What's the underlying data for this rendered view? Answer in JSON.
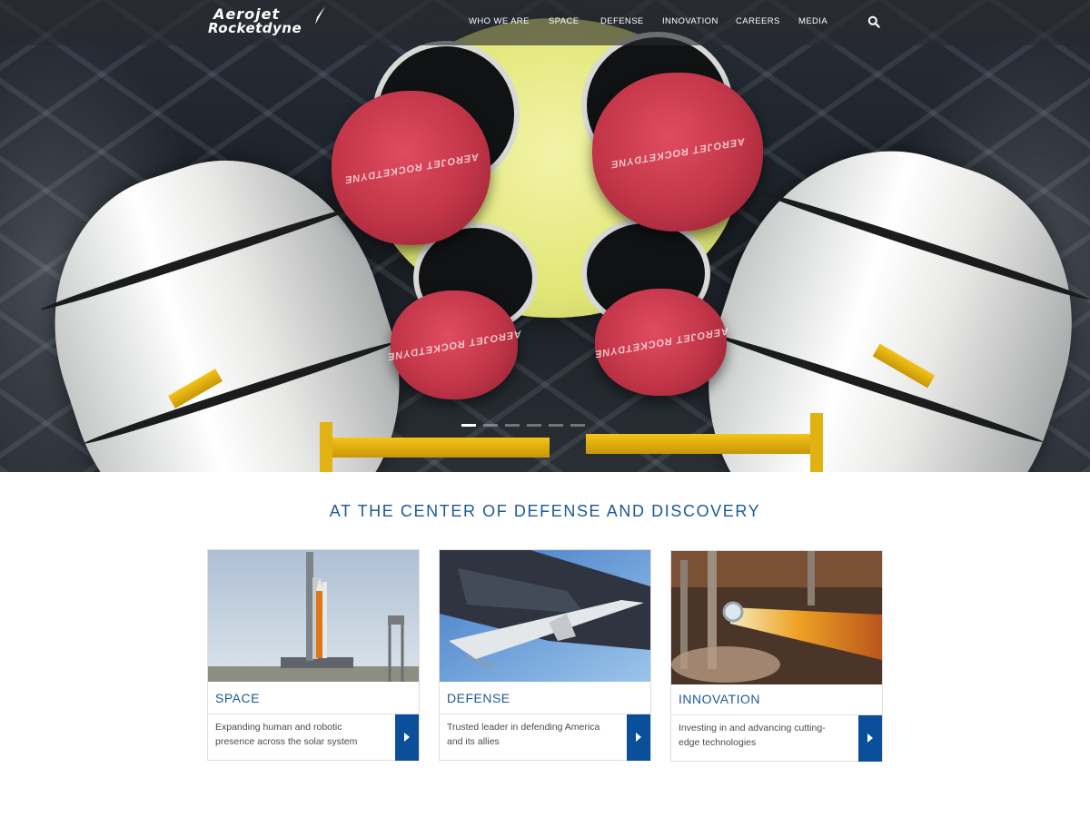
{
  "brand": {
    "logo_line1": "Aerojet",
    "logo_line2": "Rocketdyne",
    "primary_color": "#1c5a96",
    "accent_color": "#0b4f9a"
  },
  "nav": {
    "items": [
      {
        "label": "WHO WE ARE"
      },
      {
        "label": "SPACE"
      },
      {
        "label": "DEFENSE"
      },
      {
        "label": "INNOVATION"
      },
      {
        "label": "CAREERS"
      },
      {
        "label": "MEDIA"
      }
    ],
    "search_icon": "search-icon"
  },
  "hero": {
    "cover_stamp": "AEROJET ROCKETDYNE",
    "slider": {
      "total": 6,
      "active": 1
    }
  },
  "main": {
    "title": "AT THE CENTER OF DEFENSE AND DISCOVERY",
    "cards": [
      {
        "name": "SPACE",
        "description": "Expanding human and robotic presence across the solar system",
        "arrow_icon": "chevron-right-icon"
      },
      {
        "name": "DEFENSE",
        "description": "Trusted leader in defending America and its allies",
        "arrow_icon": "chevron-right-icon"
      },
      {
        "name": "INNOVATION",
        "description": "Investing in and advancing cutting-edge technologies",
        "arrow_icon": "chevron-right-icon"
      }
    ]
  }
}
